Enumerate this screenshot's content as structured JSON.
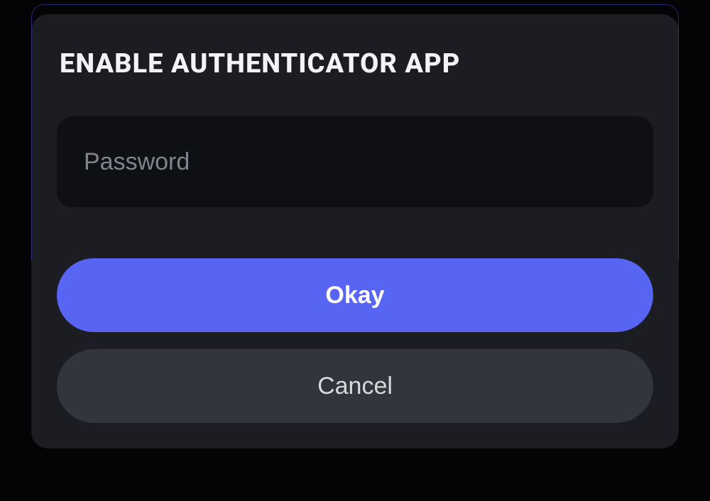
{
  "modal": {
    "title": "ENABLE AUTHENTICATOR APP",
    "password_placeholder": "Password",
    "okay_label": "Okay",
    "cancel_label": "Cancel"
  }
}
